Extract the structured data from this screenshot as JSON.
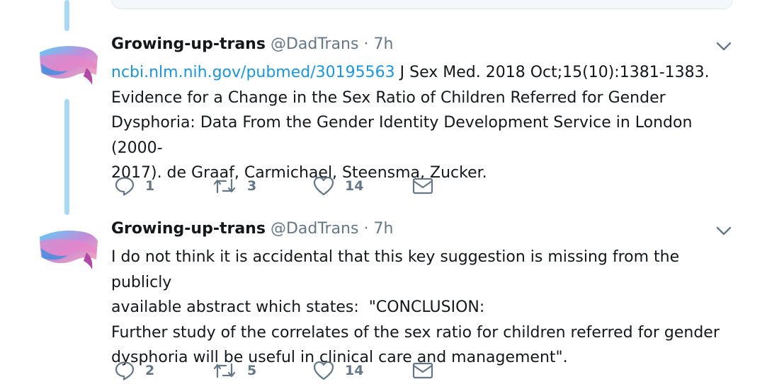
{
  "tweets": [
    {
      "name": "Growing-up-trans",
      "handle": "@DadTrans",
      "separator": "·",
      "time": "7h",
      "link": "ncbi.nlm.nih.gov/pubmed/30195563",
      "text": " J Sex Med. 2018 Oct;15(10):1381-1383.\nEvidence for a Change in the Sex Ratio of Children Referred for Gender\nDysphoria: Data From the Gender Identity Development Service in London (2000-\n2017). de Graaf, Carmichael, Steensma, Zucker.",
      "replies": "1",
      "retweets": "3",
      "likes": "14",
      "icons": {
        "reply": "reply-icon",
        "retweet": "retweet-icon",
        "like": "heart-icon",
        "dm": "envelope-icon",
        "menu": "chevron-down-icon"
      }
    },
    {
      "name": "Growing-up-trans",
      "handle": "@DadTrans",
      "separator": "·",
      "time": "7h",
      "link": "",
      "text": "I do not think it is accidental that this key suggestion is missing from the publicly\navailable abstract which states:  \"CONCLUSION:\nFurther study of the correlates of the sex ratio for children referred for gender\ndysphoria will be useful in clinical care and management\".",
      "replies": "2",
      "retweets": "5",
      "likes": "14",
      "icons": {
        "reply": "reply-icon",
        "retweet": "retweet-icon",
        "like": "heart-icon",
        "dm": "envelope-icon",
        "menu": "chevron-down-icon"
      }
    }
  ],
  "colors": {
    "thread_line": "#a9d8f5",
    "link": "#1b95e0",
    "muted": "#657786",
    "avatar_pink": "#f5a9b8",
    "avatar_blue": "#5bcefa"
  }
}
